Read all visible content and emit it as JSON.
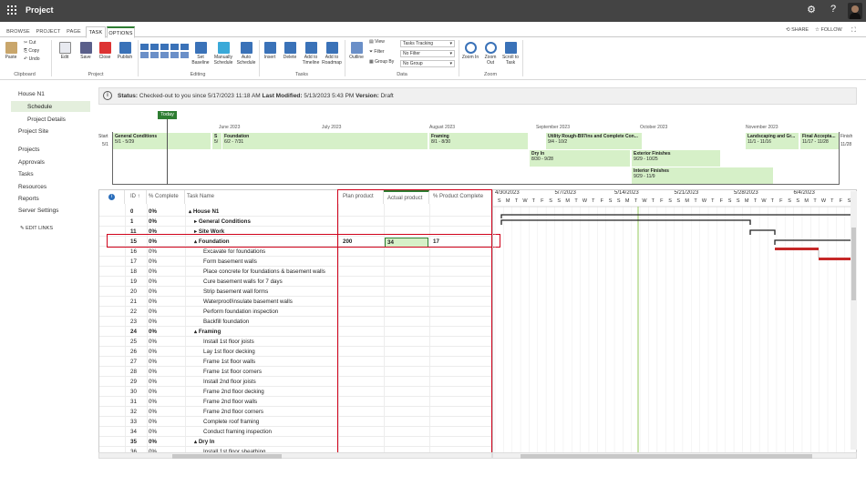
{
  "app": {
    "title": "Project"
  },
  "topbar": {
    "icons": [
      "gear-icon",
      "help-icon",
      "avatar"
    ]
  },
  "tabs": [
    {
      "label": "BROWSE"
    },
    {
      "label": "PROJECT"
    },
    {
      "label": "PAGE"
    },
    {
      "label": "TASK"
    },
    {
      "label": "OPTIONS"
    }
  ],
  "tabs_right": {
    "share": "SHARE",
    "follow": "FOLLOW"
  },
  "ribbon": {
    "clipboard": {
      "paste": "Paste",
      "cut": "Cut",
      "copy": "Copy",
      "undo": "Undo",
      "group": "Clipboard"
    },
    "project": {
      "edit": "Edit",
      "save": "Save",
      "close": "Close",
      "publish": "Publish",
      "group": "Project"
    },
    "editing": {
      "set_baseline": "Set Baseline",
      "manually_schedule": "Manually Schedule",
      "auto_schedule": "Auto Schedule",
      "group": "Editing"
    },
    "tasks": {
      "insert": "Insert",
      "delete": "Delete",
      "add_to_timeline": "Add to Timeline",
      "add_to_roadmap": "Add to Roadmap",
      "group": "Tasks"
    },
    "data": {
      "outline": "Outline",
      "view": "View",
      "filter": "Filter",
      "group_by": "Group By",
      "view_value": "Tasks Tracking",
      "filter_value": "No Filter",
      "group_value": "No Group",
      "group": "Data"
    },
    "zoom": {
      "zoom_in": "Zoom In",
      "zoom_out": "Zoom Out",
      "scroll_to_task": "Scroll to Task",
      "group": "Zoom"
    }
  },
  "nav": {
    "items": [
      "House N1",
      "Schedule",
      "Project Details",
      "Project Site",
      "Projects",
      "Approvals",
      "Tasks",
      "Resources",
      "Reports",
      "Server Settings"
    ],
    "edit_links": "EDIT LINKS"
  },
  "status": {
    "label": "Status:",
    "text1": "Checked-out to you since 5/17/2023 11:18 AM",
    "lm_label": "Last Modified:",
    "text2": "5/13/2023 5:43 PM",
    "ver_label": "Version:",
    "text3": "Draft"
  },
  "timeline": {
    "today": "Today",
    "start_label": "Start",
    "start_date": "5/1",
    "finish_label": "Finish",
    "finish_date": "11/28",
    "months": [
      "June 2023",
      "July 2023",
      "August 2023",
      "September 2023",
      "October 2023",
      "November 2023"
    ],
    "bars": [
      {
        "name": "General Conditions",
        "dates": "5/1 - 5/29"
      },
      {
        "name": "S",
        "dates": "5/"
      },
      {
        "name": "Foundation",
        "dates": "6/2 - 7/31"
      },
      {
        "name": "Framing",
        "dates": "8/1 - 8/30"
      },
      {
        "name": "Utility Rough-B97ins and Complete Con...",
        "dates": "9/4 - 10/2"
      },
      {
        "name": "Landscaping and Gr...",
        "dates": "11/1 - 11/16"
      },
      {
        "name": "Final Accepta...",
        "dates": "11/17 - 11/28"
      },
      {
        "name": "Dry In",
        "dates": "8/30 - 9/28"
      },
      {
        "name": "Exterior Finishes",
        "dates": "9/29 - 10/25"
      },
      {
        "name": "Interior Finishes",
        "dates": "9/29 - 11/9"
      }
    ]
  },
  "grid": {
    "headers": {
      "id": "ID ↑",
      "pct": "% Complete",
      "name": "Task Name",
      "plan": "Plan product",
      "actual": "Actual product",
      "ppc": "% Product Complete"
    },
    "rows": [
      {
        "id": "0",
        "pct": "0%",
        "name": "▴ House N1",
        "plan": "",
        "actual": "",
        "ppc": ""
      },
      {
        "id": "1",
        "pct": "0%",
        "name": "▸ General Conditions",
        "plan": "",
        "actual": "",
        "ppc": ""
      },
      {
        "id": "11",
        "pct": "0%",
        "name": "▸ Site Work",
        "plan": "",
        "actual": "",
        "ppc": ""
      },
      {
        "id": "15",
        "pct": "0%",
        "name": "▴ Foundation",
        "plan": "200",
        "actual": "34",
        "ppc": "17"
      },
      {
        "id": "16",
        "pct": "0%",
        "name": "Excavate for foundations",
        "plan": "",
        "actual": "",
        "ppc": ""
      },
      {
        "id": "17",
        "pct": "0%",
        "name": "Form basement walls",
        "plan": "",
        "actual": "",
        "ppc": ""
      },
      {
        "id": "18",
        "pct": "0%",
        "name": "Place concrete for foundations & basement walls",
        "plan": "",
        "actual": "",
        "ppc": ""
      },
      {
        "id": "19",
        "pct": "0%",
        "name": "Cure basement walls for 7 days",
        "plan": "",
        "actual": "",
        "ppc": ""
      },
      {
        "id": "20",
        "pct": "0%",
        "name": "Strip basement wall forms",
        "plan": "",
        "actual": "",
        "ppc": ""
      },
      {
        "id": "21",
        "pct": "0%",
        "name": "Waterproof/insulate basement walls",
        "plan": "",
        "actual": "",
        "ppc": ""
      },
      {
        "id": "22",
        "pct": "0%",
        "name": "Perform foundation inspection",
        "plan": "",
        "actual": "",
        "ppc": ""
      },
      {
        "id": "23",
        "pct": "0%",
        "name": "Backfill foundation",
        "plan": "",
        "actual": "",
        "ppc": ""
      },
      {
        "id": "24",
        "pct": "0%",
        "name": "▴ Framing",
        "plan": "",
        "actual": "",
        "ppc": ""
      },
      {
        "id": "25",
        "pct": "0%",
        "name": "Install 1st floor joists",
        "plan": "",
        "actual": "",
        "ppc": ""
      },
      {
        "id": "26",
        "pct": "0%",
        "name": "Lay 1st floor decking",
        "plan": "",
        "actual": "",
        "ppc": ""
      },
      {
        "id": "27",
        "pct": "0%",
        "name": "Frame 1st floor walls",
        "plan": "",
        "actual": "",
        "ppc": ""
      },
      {
        "id": "28",
        "pct": "0%",
        "name": "Frame 1st floor corners",
        "plan": "",
        "actual": "",
        "ppc": ""
      },
      {
        "id": "29",
        "pct": "0%",
        "name": "Install 2nd floor joists",
        "plan": "",
        "actual": "",
        "ppc": ""
      },
      {
        "id": "30",
        "pct": "0%",
        "name": "Frame 2nd floor decking",
        "plan": "",
        "actual": "",
        "ppc": ""
      },
      {
        "id": "31",
        "pct": "0%",
        "name": "Frame 2nd floor walls",
        "plan": "",
        "actual": "",
        "ppc": ""
      },
      {
        "id": "32",
        "pct": "0%",
        "name": "Frame 2nd floor corners",
        "plan": "",
        "actual": "",
        "ppc": ""
      },
      {
        "id": "33",
        "pct": "0%",
        "name": "Complete roof framing",
        "plan": "",
        "actual": "",
        "ppc": ""
      },
      {
        "id": "34",
        "pct": "0%",
        "name": "Conduct framing inspection",
        "plan": "",
        "actual": "",
        "ppc": ""
      },
      {
        "id": "35",
        "pct": "0%",
        "name": "▴ Dry In",
        "plan": "",
        "actual": "",
        "ppc": ""
      },
      {
        "id": "36",
        "pct": "0%",
        "name": "Install 1st floor sheathing",
        "plan": "",
        "actual": "",
        "ppc": ""
      }
    ]
  },
  "gantt": {
    "weeks": [
      "4/30/2023",
      "5/7/2023",
      "5/14/2023",
      "5/21/2023",
      "5/28/2023",
      "6/4/2023"
    ],
    "days": [
      "S",
      "M",
      "T",
      "W",
      "T",
      "F",
      "S"
    ]
  },
  "colors": {
    "accent": "#2e7d32",
    "highlight": "#d0021b",
    "timeline_bar": "#d6f0c8",
    "selected_nav": "#e4efdd"
  }
}
